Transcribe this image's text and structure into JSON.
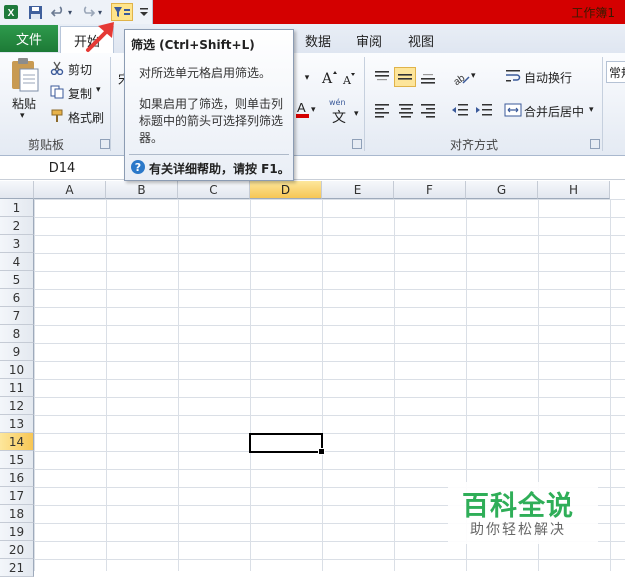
{
  "window": {
    "title": "工作簿1"
  },
  "qat": {
    "excel_icon": "excel-icon",
    "save_icon": "save-icon",
    "undo_icon": "undo-icon",
    "redo_icon": "redo-icon",
    "filter_icon": "filter-icon",
    "customize_icon": "customize-qat-icon"
  },
  "tabs": {
    "file": "文件",
    "home": "开始",
    "data": "数据",
    "review": "审阅",
    "view": "视图"
  },
  "ribbon": {
    "paste": "粘贴",
    "cut": "剪切",
    "copy": "复制",
    "format_painter": "格式刷",
    "clipboard_group": "剪贴板",
    "font_wen": "wén",
    "font_wen_char": "文",
    "wrap_text": "自动换行",
    "merge_center": "合并后居中",
    "alignment_group": "对齐方式",
    "number_partial": "常规",
    "font_partial": "宋"
  },
  "formula": {
    "name_box": "D14"
  },
  "columns": [
    "A",
    "B",
    "C",
    "D",
    "E",
    "F",
    "G",
    "H"
  ],
  "rows": [
    "1",
    "2",
    "3",
    "4",
    "5",
    "6",
    "7",
    "8",
    "9",
    "10",
    "11",
    "12",
    "13",
    "14",
    "15",
    "16",
    "17",
    "18",
    "19",
    "20",
    "21"
  ],
  "tooltip": {
    "title": "筛选 (Ctrl+Shift+L)",
    "line1": "对所选单元格启用筛选。",
    "body": "如果启用了筛选，则单击列标题中的箭头可选择列筛选器。",
    "help": "有关详细帮助，请按 F1。"
  },
  "watermark": {
    "main": "百科全说",
    "sub": "助你轻松解决"
  },
  "colors": {
    "title_bar": "#d40000",
    "file_tab": "#1d7a36",
    "selection_header": "#f7c655",
    "watermark": "#2fae58",
    "arrow": "#e53935"
  }
}
